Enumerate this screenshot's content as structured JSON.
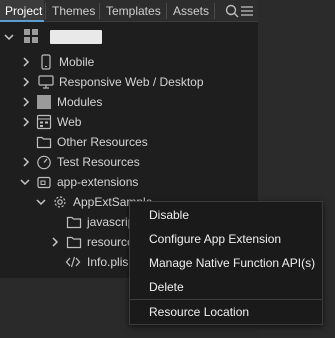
{
  "tabs": [
    {
      "label": "Project",
      "active": true
    },
    {
      "label": "Themes",
      "active": false
    },
    {
      "label": "Templates",
      "active": false
    },
    {
      "label": "Assets",
      "active": false
    }
  ],
  "toolbar_icons": [
    "search-icon",
    "menu-icon"
  ],
  "project": {
    "icon": "grid-icon",
    "expanded": true
  },
  "tree": [
    {
      "label": "Mobile",
      "icon": "mobile-icon",
      "expanded": false
    },
    {
      "label": "Responsive Web / Desktop",
      "icon": "desktop-icon",
      "expanded": false
    },
    {
      "label": "Modules",
      "icon": "modules-icon",
      "expanded": false
    },
    {
      "label": "Web",
      "icon": "web-icon",
      "expanded": false
    },
    {
      "label": "Other Resources",
      "icon": "folder-icon",
      "expanded": null
    },
    {
      "label": "Test Resources",
      "icon": "gauge-icon",
      "expanded": false
    },
    {
      "label": "app-extensions",
      "icon": "extension-icon",
      "expanded": true
    },
    {
      "label": "AppExtSample",
      "icon": "gear-icon",
      "expanded": true
    },
    {
      "label": "javascrip",
      "icon": "folder-icon",
      "expanded": null
    },
    {
      "label": "resource",
      "icon": "folder-icon",
      "expanded": false
    },
    {
      "label": "Info.plis",
      "icon": "code-icon",
      "expanded": null
    }
  ],
  "context_menu": {
    "items": [
      "Disable",
      "Configure App Extension",
      "Manage Native Function API(s)",
      "Delete",
      "Resource Location"
    ]
  },
  "colors": {
    "background": "#1e1e1e",
    "menu_background": "#1a1a1a",
    "text": "#d4d4d4",
    "active_tab_underline": "#5a9fd4"
  }
}
